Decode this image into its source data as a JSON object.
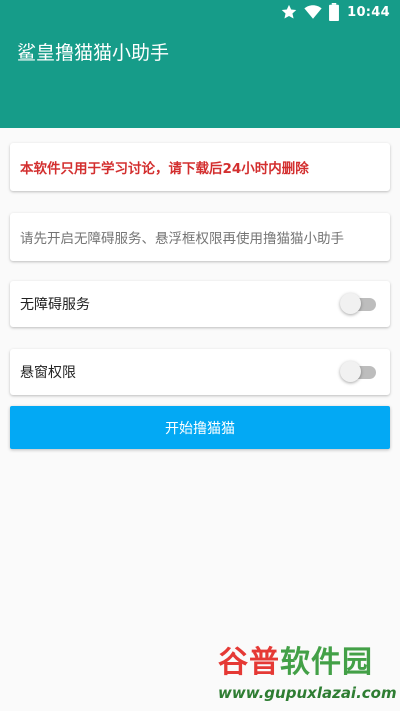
{
  "status_bar": {
    "time": "10:44",
    "icons": [
      "star-icon",
      "wifi-icon",
      "battery-icon"
    ]
  },
  "app": {
    "title": "鲨皇撸猫猫小助手"
  },
  "notice": {
    "text": "本软件只用于学习讨论，请下载后24小时内删除",
    "color": "#d32f2f"
  },
  "hint": {
    "text": "请先开启无障碍服务、悬浮框权限再使用撸猫猫小助手"
  },
  "settings": {
    "accessibility": {
      "label": "无障碍服务",
      "enabled": false
    },
    "floating_window": {
      "label": "悬窗权限",
      "enabled": false
    }
  },
  "start_button": {
    "label": "开始撸猫猫",
    "color": "#03a9f4"
  },
  "watermark": {
    "part1": "谷普",
    "part2": "软件园",
    "url": "www.gupuxlazai.com"
  },
  "colors": {
    "toolbar": "#169c89",
    "background": "#fafafa"
  }
}
